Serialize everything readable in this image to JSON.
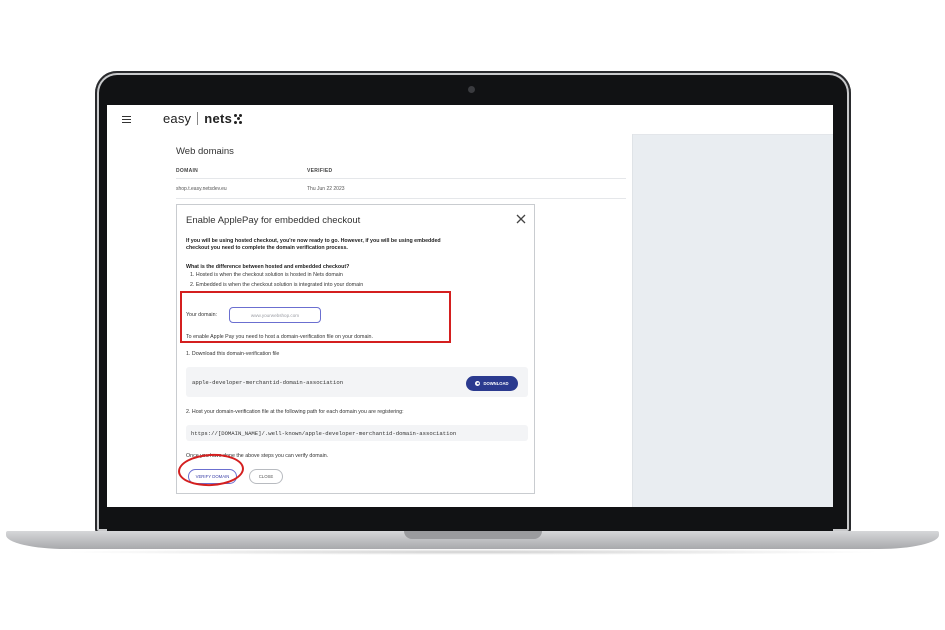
{
  "app": {
    "logo_left": "easy",
    "logo_right": "nets"
  },
  "page": {
    "title": "Web domains",
    "columns": [
      "DOMAIN",
      "VERIFIED"
    ],
    "rows": [
      {
        "domain": "shop.t.easy.netsdev.eu",
        "verified": "Thu Jun 22 2023"
      }
    ]
  },
  "modal": {
    "title": "Enable ApplePay for embedded checkout",
    "intro_line1": "If you will be using hosted checkout, you're now ready to go. However, if you will be using embedded",
    "intro_line2": "checkout you need to complete the domain verification process.",
    "question": "What is the difference between hosted and embedded checkout?",
    "answer1": "1. Hosted is when the checkout solution is hosted in Nets domain",
    "answer2": "2. Embedded is when the checkout solution is integrated into your domain",
    "domain_label": "Your domain:",
    "domain_placeholder": "www.yourwebshop.com",
    "host_note": "To enable Apple Pay you need to host a domain-verification file on your domain.",
    "step1": "1. Download this domain-verification file",
    "file_name": "apple-developer-merchantid-domain-association",
    "download_label": "DOWNLOAD",
    "step2": "2. Host your domain-verification file at the following path for each domain you are registering:",
    "path": "https://[DOMAIN_NAME]/.well-known/apple-developer-merchantid-domain-association",
    "final_note": "Once you have done the above steps you can verify domain.",
    "verify_label": "VERIFY DOMAIN",
    "close_label": "CLOSE"
  },
  "colors": {
    "primary_button": "#2b3a8f",
    "annotation": "#d41f1f"
  }
}
